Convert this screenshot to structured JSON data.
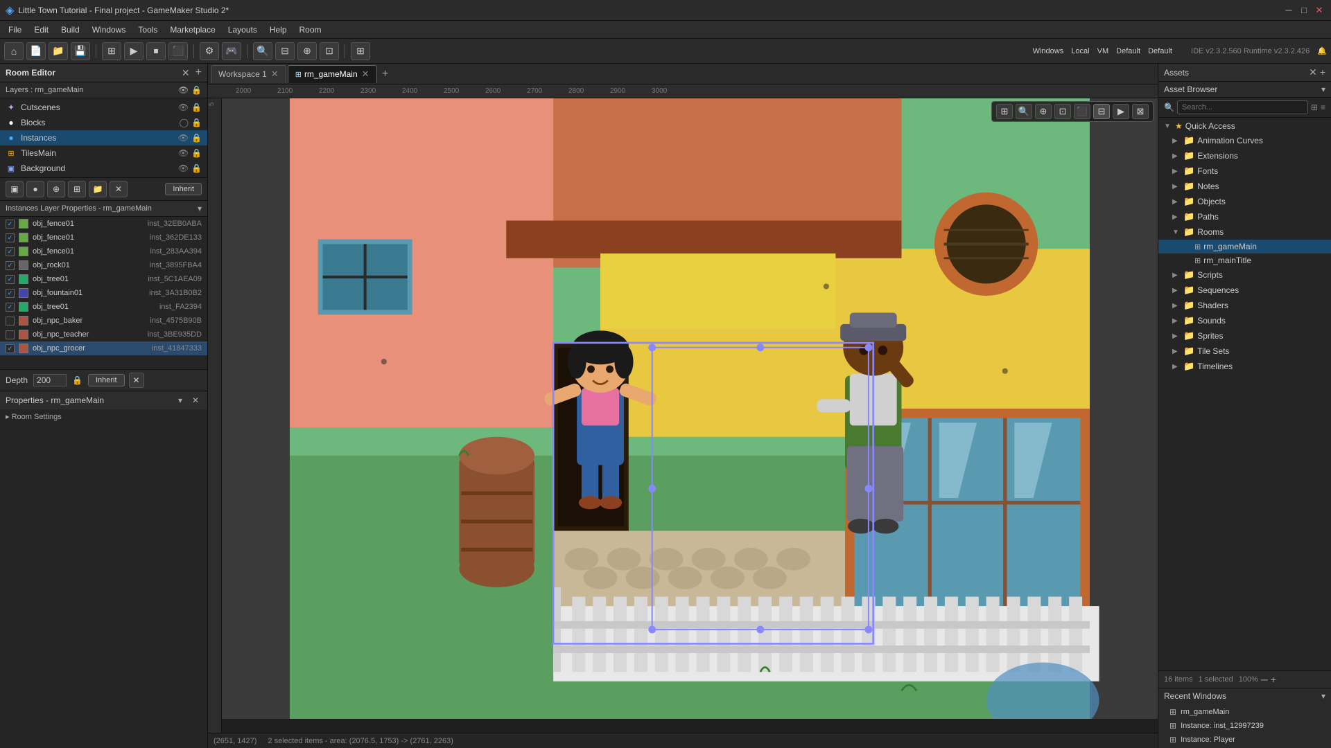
{
  "titlebar": {
    "title": "Little Town Tutorial - Final project - GameMaker Studio 2*",
    "minimize": "─",
    "maximize": "□",
    "close": "✕",
    "ide_info": "IDE v2.3.2.560  Runtime v2.3.2.426"
  },
  "menubar": {
    "items": [
      "File",
      "Edit",
      "Build",
      "Windows",
      "Tools",
      "Marketplace",
      "Layouts",
      "Help",
      "Room"
    ]
  },
  "toolbar": {
    "windows_label": "Windows",
    "local_label": "Local",
    "vm_label": "VM",
    "default1_label": "Default",
    "default2_label": "Default"
  },
  "left_panel": {
    "room_editor_title": "Room Editor",
    "layers_label": "Layers : rm_gameMain",
    "layers": [
      {
        "name": "Cutscenes",
        "icon": "✦",
        "visible": true,
        "locked": false
      },
      {
        "name": "Blocks",
        "icon": "●",
        "visible": true,
        "locked": false
      },
      {
        "name": "Instances",
        "icon": "●",
        "visible": true,
        "locked": false,
        "active": true
      },
      {
        "name": "TilesMain",
        "icon": "⊞",
        "visible": true,
        "locked": false
      },
      {
        "name": "Background",
        "icon": "▣",
        "visible": true,
        "locked": false
      }
    ],
    "instance_tools": [
      "▣",
      "●",
      "⊕",
      "⊞",
      "📁",
      "✕"
    ],
    "inherit_label": "Inherit",
    "inst_layer_title": "Instances Layer Properties - rm_gameMain",
    "instances": [
      {
        "name": "obj_fence01",
        "id": "inst_32EB0ABA",
        "selected": false
      },
      {
        "name": "obj_fence01",
        "id": "inst_362DE133",
        "selected": false
      },
      {
        "name": "obj_fence01",
        "id": "inst_283AA394",
        "selected": false
      },
      {
        "name": "obj_rock01",
        "id": "inst_3895FBA4",
        "selected": false
      },
      {
        "name": "obj_tree01",
        "id": "inst_5C1AEA09",
        "selected": false
      },
      {
        "name": "obj_fountain01",
        "id": "inst_3A31B0B2",
        "selected": false
      },
      {
        "name": "obj_tree01",
        "id": "inst_FA2394",
        "selected": false
      },
      {
        "name": "obj_npc_baker",
        "id": "inst_4575B90B",
        "selected": false
      },
      {
        "name": "obj_npc_teacher",
        "id": "inst_3BE935DD",
        "selected": false
      },
      {
        "name": "obj_npc_grocer",
        "id": "inst_41847333",
        "selected": true
      }
    ],
    "depth_label": "Depth",
    "depth_value": "200",
    "inherit2_label": "Inherit",
    "properties_title": "Properties - rm_gameMain",
    "room_settings": "▸ Room Settings"
  },
  "workspace_tab": {
    "label": "Workspace 1",
    "close": "✕"
  },
  "room_tab": {
    "label": "rm_gameMain",
    "close": "✕"
  },
  "ruler": {
    "ticks": [
      "2000",
      "2100",
      "2200",
      "2300",
      "2400",
      "2500",
      "2600",
      "2700",
      "2800",
      "2900",
      "3000"
    ]
  },
  "canvas_toolbar": {
    "btns": [
      "⊞",
      "🔍-",
      "🔍+",
      "⊡",
      "⊟",
      "⬛",
      "▶",
      "⏹"
    ]
  },
  "statusbar": {
    "coords": "(2651, 1427)",
    "selection_info": "2 selected items - area: (2076.5, 1753) -> (2761, 2263)"
  },
  "assets_panel": {
    "title": "Assets",
    "close": "✕",
    "add": "+",
    "browser_label": "Asset Browser",
    "search_placeholder": "Search...",
    "tree": [
      {
        "label": "Quick Access",
        "type": "folder",
        "open": true,
        "indent": 0,
        "star": true
      },
      {
        "label": "Animation Curves",
        "type": "folder",
        "open": false,
        "indent": 1
      },
      {
        "label": "Extensions",
        "type": "folder",
        "open": false,
        "indent": 1
      },
      {
        "label": "Fonts",
        "type": "folder",
        "open": false,
        "indent": 1
      },
      {
        "label": "Notes",
        "type": "folder",
        "open": false,
        "indent": 1
      },
      {
        "label": "Objects",
        "type": "folder",
        "open": false,
        "indent": 1
      },
      {
        "label": "Paths",
        "type": "folder",
        "open": false,
        "indent": 1
      },
      {
        "label": "Rooms",
        "type": "folder",
        "open": true,
        "indent": 1
      },
      {
        "label": "rm_gameMain",
        "type": "file",
        "indent": 2,
        "selected": true
      },
      {
        "label": "rm_mainTitle",
        "type": "file",
        "indent": 2
      },
      {
        "label": "Scripts",
        "type": "folder",
        "open": false,
        "indent": 1
      },
      {
        "label": "Sequences",
        "type": "folder",
        "open": false,
        "indent": 1
      },
      {
        "label": "Shaders",
        "type": "folder",
        "open": false,
        "indent": 1
      },
      {
        "label": "Sounds",
        "type": "folder",
        "open": false,
        "indent": 1
      },
      {
        "label": "Sprites",
        "type": "folder",
        "open": false,
        "indent": 1
      },
      {
        "label": "Tile Sets",
        "type": "folder",
        "open": false,
        "indent": 1
      },
      {
        "label": "Timelines",
        "type": "folder",
        "open": false,
        "indent": 1
      }
    ],
    "footer_count": "16 items",
    "footer_selected": "1 selected",
    "footer_zoom": "100%"
  },
  "recent_windows": {
    "title": "Recent Windows",
    "items": [
      {
        "label": "rm_gameMain",
        "icon": "⊞"
      },
      {
        "label": "Instance: inst_12997239",
        "icon": "⊞"
      },
      {
        "label": "Instance: Player",
        "icon": "⊞"
      }
    ]
  }
}
